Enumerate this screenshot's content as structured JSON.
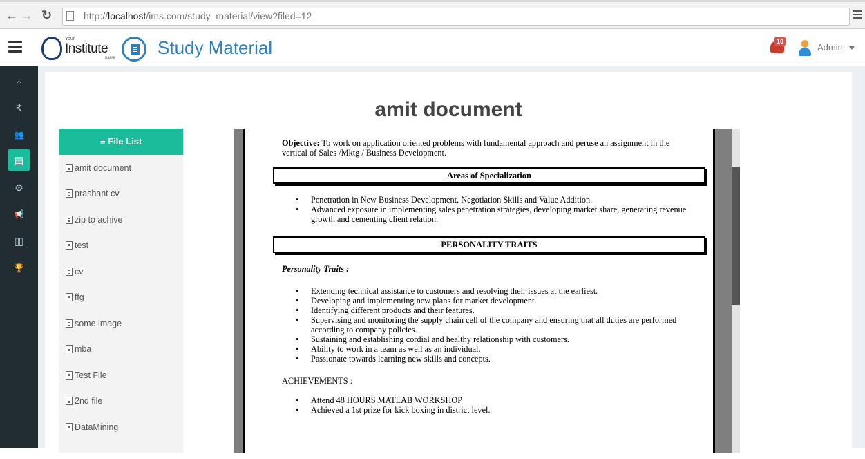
{
  "browser": {
    "url_prefix": "http://",
    "url_host": "localhost",
    "url_path": "/ims.com/study_material/view?filed=12"
  },
  "header": {
    "logo_top": "Your",
    "logo_name": "Institute",
    "logo_bottom": "name",
    "page_title": "Study Material",
    "notification_count": "10",
    "user_label": "Admin"
  },
  "sidebar": {
    "items": [
      {
        "icon": "home-icon",
        "glyph": "⌂"
      },
      {
        "icon": "rupee-icon",
        "glyph": "₹"
      },
      {
        "icon": "users-icon",
        "glyph": "👥"
      },
      {
        "icon": "document-icon",
        "glyph": "▤"
      },
      {
        "icon": "gears-icon",
        "glyph": "⚙"
      },
      {
        "icon": "bullhorn-icon",
        "glyph": "📢"
      },
      {
        "icon": "bar-chart-icon",
        "glyph": "▥"
      },
      {
        "icon": "trophy-icon",
        "glyph": "🏆"
      }
    ]
  },
  "main": {
    "doc_title": "amit document",
    "file_list_header": "≡ File List",
    "files": [
      "amit document",
      "prashant cv",
      "zip to achive",
      "test",
      "cv",
      "ffg",
      "some image",
      "mba",
      "Test File",
      "2nd file",
      "DataMining"
    ]
  },
  "document": {
    "objective_label": "Objective:",
    "objective_text": " To work on application oriented problems with fundamental approach and peruse an assignment in the vertical of Sales /Mktg / Business  Development.",
    "section1": "Areas of Specialization",
    "section1_items": [
      "Penetration in New Business Development, Negotiation Skills and Value Addition.",
      "Advanced exposure in implementing sales penetration strategies, developing market share, generating revenue growth and cementing client relation."
    ],
    "section2": "PERSONALITY TRAITS",
    "traits_title": "Personality Traits :",
    "traits_items": [
      "Extending technical assistance to customers and resolving their issues at the earliest.",
      "Developing and implementing new plans for market development.",
      "Identifying different products and their features.",
      "Supervising and monitoring the supply chain cell of the company and ensuring that all duties are performed according to company policies.",
      "Sustaining and establishing cordial and healthy relationship with customers.",
      "Ability to work in a team as well as an individual.",
      "Passionate towards learning new skills and concepts."
    ],
    "achievements_title": "ACHIEVEMENTS :",
    "achievements_items": [
      "Attend 48 HOURS MATLAB WORKSHOP",
      "Achieved a 1st prize for kick boxing in district level."
    ]
  }
}
